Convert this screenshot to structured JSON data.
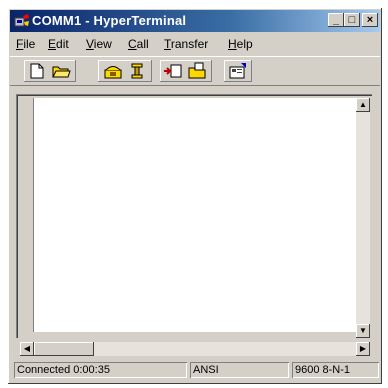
{
  "window": {
    "title": "COMM1 - HyperTerminal",
    "controls": {
      "minimize": "_",
      "maximize": "□",
      "close": "×"
    }
  },
  "menu": {
    "items": [
      {
        "label": "File",
        "underline": "F",
        "rest": "ile"
      },
      {
        "label": "Edit",
        "underline": "E",
        "rest": "dit"
      },
      {
        "label": "View",
        "underline": "V",
        "rest": "iew"
      },
      {
        "label": "Call",
        "underline": "C",
        "rest": "all"
      },
      {
        "label": "Transfer",
        "underline": "T",
        "rest": "ransfer"
      },
      {
        "label": "Help",
        "underline": "H",
        "rest": "elp"
      }
    ]
  },
  "toolbar": {
    "buttons": [
      "new-connection-icon",
      "open-icon",
      "connect-icon",
      "disconnect-icon",
      "send-icon",
      "receive-icon",
      "properties-icon"
    ]
  },
  "status": {
    "connection": "Connected 0:00:35",
    "emulation": "ANSI",
    "settings": "9600 8-N-1"
  },
  "colors": {
    "title_start": "#0a246a",
    "title_end": "#a6caf0",
    "face": "#d4d0c8"
  }
}
